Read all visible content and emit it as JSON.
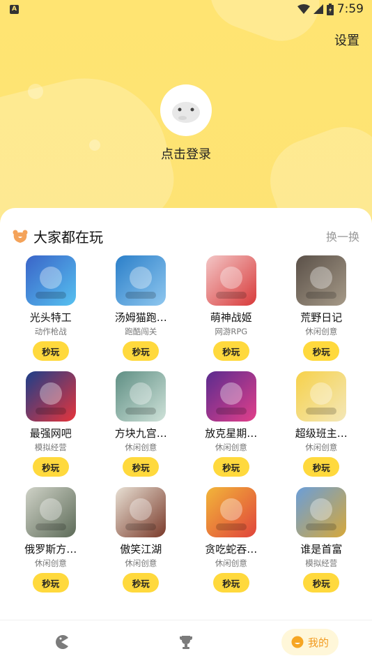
{
  "status_bar": {
    "time": "7:59",
    "app_badge": "A"
  },
  "header": {
    "settings_label": "设置",
    "login_label": "点击登录"
  },
  "section": {
    "title": "大家都在玩",
    "refresh_label": "换一换"
  },
  "play_label": "秒玩",
  "games": [
    {
      "name": "光头特工",
      "category": "动作枪战",
      "icon": "bald-agent-game-icon",
      "colors": [
        "#3a64c8",
        "#56c1f0"
      ]
    },
    {
      "name": "汤姆猫跑…",
      "category": "跑酷闯关",
      "icon": "tom-cat-run-game-icon",
      "colors": [
        "#2b7fc9",
        "#8fc7ef"
      ]
    },
    {
      "name": "萌神战姬",
      "category": "网游RPG",
      "icon": "cute-war-princess-game-icon",
      "colors": [
        "#f3c6c6",
        "#d83a3a"
      ]
    },
    {
      "name": "荒野日记",
      "category": "休闲创意",
      "icon": "wilderness-diary-game-icon",
      "colors": [
        "#5a5048",
        "#a69a88"
      ]
    },
    {
      "name": "最强网吧",
      "category": "模拟经营",
      "icon": "internet-cafe-game-icon",
      "colors": [
        "#1c3f8a",
        "#e7343b"
      ]
    },
    {
      "name": "方块九宫…",
      "category": "休闲创意",
      "icon": "block-nine-grid-game-icon",
      "colors": [
        "#5f8f84",
        "#cfe2d9"
      ]
    },
    {
      "name": "放克星期…",
      "category": "休闲创意",
      "icon": "funky-friday-game-icon",
      "colors": [
        "#5a2c8f",
        "#e23f8a"
      ]
    },
    {
      "name": "超级班主…",
      "category": "休闲创意",
      "icon": "super-teacher-game-icon",
      "colors": [
        "#f6d14a",
        "#f3e7b9"
      ]
    },
    {
      "name": "俄罗斯方…",
      "category": "休闲创意",
      "icon": "tetris-game-icon",
      "colors": [
        "#cfd2c7",
        "#5d6b58"
      ]
    },
    {
      "name": "傲笑江湖",
      "category": "休闲创意",
      "icon": "proud-jianghu-game-icon",
      "colors": [
        "#e8e0d4",
        "#7a3a2a"
      ]
    },
    {
      "name": "贪吃蛇吞…",
      "category": "休闲创意",
      "icon": "snake-devour-game-icon",
      "colors": [
        "#f2b63a",
        "#e0443b"
      ]
    },
    {
      "name": "谁是首富",
      "category": "模拟经营",
      "icon": "richest-man-game-icon",
      "colors": [
        "#6a9ed9",
        "#d6a83a"
      ]
    }
  ],
  "tabs": {
    "games_icon": "pacman-icon",
    "rank_icon": "trophy-icon",
    "mine_label": "我的",
    "accent": "#f29a1f"
  }
}
